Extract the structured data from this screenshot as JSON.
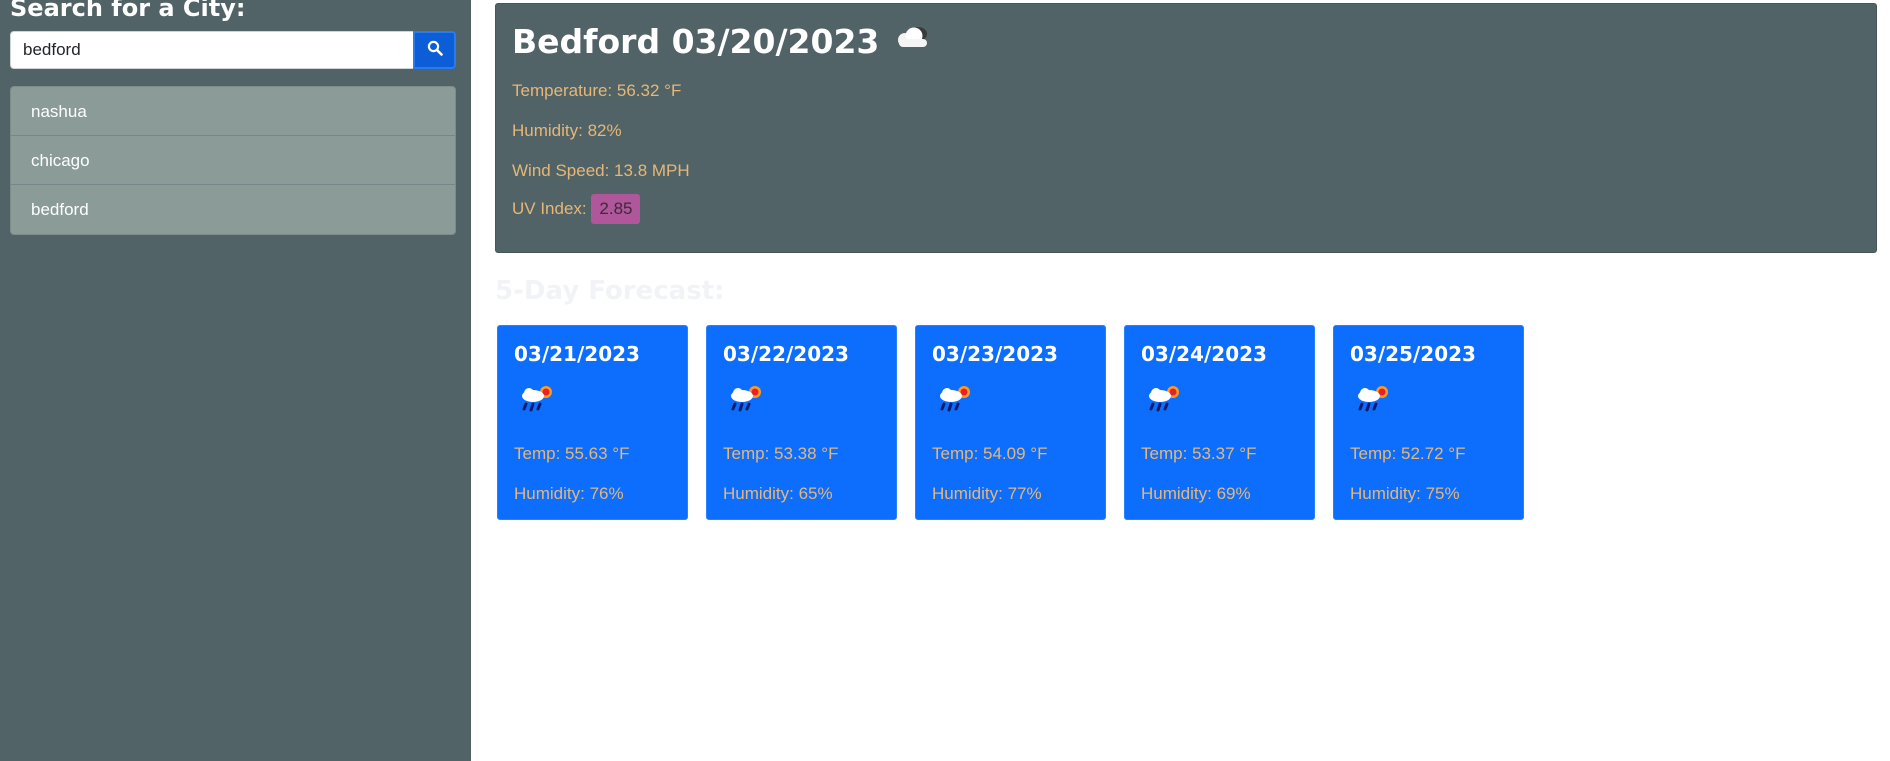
{
  "sidebar": {
    "title": "Search for a City:",
    "search_value": "bedford",
    "search_icon": "search-icon",
    "history": [
      "nashua",
      "chicago",
      "bedford"
    ]
  },
  "current": {
    "title": "Bedford 03/20/2023",
    "icon": "cloud-icon",
    "temperature": "Temperature: 56.32 °F",
    "humidity": "Humidity: 82%",
    "wind": "Wind Speed: 13.8 MPH",
    "uv_label": "UV Index:",
    "uv_value": "2.85"
  },
  "forecast": {
    "title": "5-Day Forecast:",
    "days": [
      {
        "date": "03/21/2023",
        "icon": "rain-sun-icon",
        "temp": "Temp: 55.63 °F",
        "humidity": "Humidity: 76%"
      },
      {
        "date": "03/22/2023",
        "icon": "rain-sun-icon",
        "temp": "Temp: 53.38 °F",
        "humidity": "Humidity: 65%"
      },
      {
        "date": "03/23/2023",
        "icon": "rain-sun-icon",
        "temp": "Temp: 54.09 °F",
        "humidity": "Humidity: 77%"
      },
      {
        "date": "03/24/2023",
        "icon": "rain-sun-icon",
        "temp": "Temp: 53.37 °F",
        "humidity": "Humidity: 69%"
      },
      {
        "date": "03/25/2023",
        "icon": "rain-sun-icon",
        "temp": "Temp: 52.72 °F",
        "humidity": "Humidity: 75%"
      }
    ]
  },
  "colors": {
    "sidebar_bg": "#516366",
    "card_bg": "#0d6efd",
    "stat_text": "#e6b777",
    "uv_badge": "#b0569a",
    "button": "#0b5ed7"
  }
}
